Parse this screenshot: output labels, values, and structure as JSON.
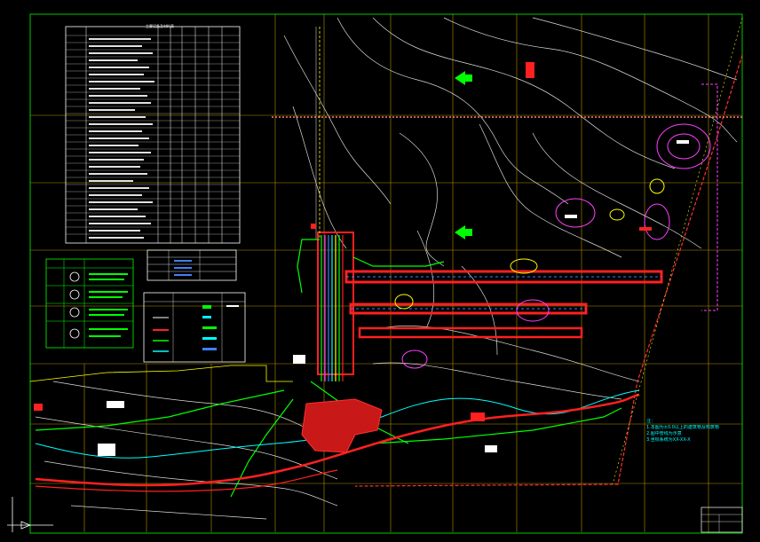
{
  "drawing": {
    "background": "#000000",
    "colors": {
      "frame": "#00c800",
      "grid": "#c8a000",
      "boundary": "#ff2020",
      "contour": "#e0e0e0",
      "pipe_blue": "#4080ff",
      "pipe_green": "#00ff00",
      "pipe_cyan": "#00ffff",
      "magenta": "#ff40ff",
      "yellow": "#ffff00"
    },
    "north_arrow_icon": "green-arrow-icon",
    "cursor_icon": "ucs-axis-icon"
  },
  "notes": {
    "heading": "注：",
    "lines": [
      "1.本图为±0.0以上的建筑物及构筑物",
      "2.图中管线为示意",
      "3.坐标系统为XX-XX-X"
    ]
  },
  "equipment_table": {
    "title": "主要设备及材料表"
  }
}
